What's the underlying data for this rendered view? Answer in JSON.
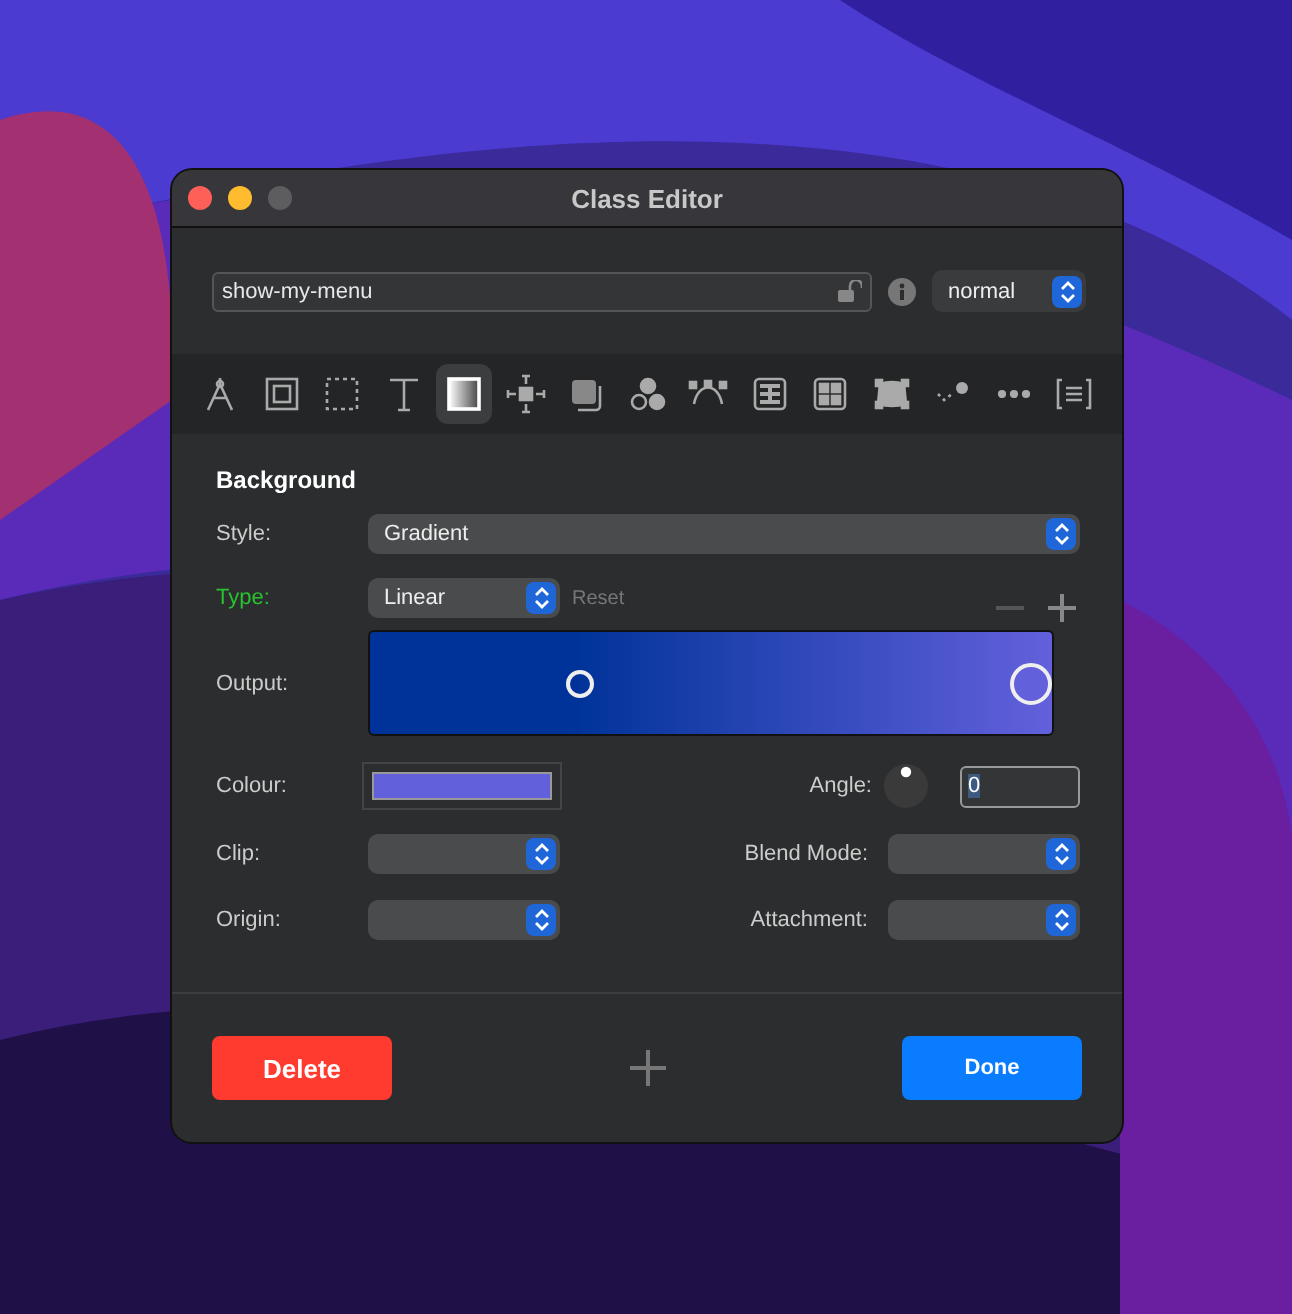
{
  "window": {
    "title": "Class Editor"
  },
  "class_field": {
    "value": "show-my-menu",
    "locked": false
  },
  "state_select": {
    "value": "normal"
  },
  "tools": [
    {
      "selected": false
    },
    {
      "selected": false
    },
    {
      "selected": false
    },
    {
      "selected": false
    },
    {
      "selected": true
    },
    {
      "selected": false
    },
    {
      "selected": false
    },
    {
      "selected": false
    },
    {
      "selected": false
    },
    {
      "selected": false
    },
    {
      "selected": false
    },
    {
      "selected": false
    },
    {
      "selected": false
    },
    {
      "selected": false
    },
    {
      "selected": false
    }
  ],
  "section": {
    "title": "Background"
  },
  "style": {
    "label": "Style:",
    "value": "Gradient"
  },
  "type": {
    "label": "Type:",
    "value": "Linear",
    "modified": true,
    "reset": "Reset"
  },
  "output": {
    "label": "Output:",
    "stops": [
      {
        "level": 0.3,
        "color": "#003399",
        "selected": false
      },
      {
        "level": 1,
        "color": "#6360dc",
        "selected": true
      }
    ]
  },
  "colour": {
    "label": "Colour:",
    "color": "#6360dc"
  },
  "angle": {
    "label": "Angle:",
    "value": "0"
  },
  "clip": {
    "label": "Clip:"
  },
  "blend_mode": {
    "label": "Blend Mode:"
  },
  "origin": {
    "label": "Origin:"
  },
  "attachment": {
    "label": "Attachment:"
  },
  "buttons": {
    "delete": "Delete",
    "done": "Done"
  }
}
